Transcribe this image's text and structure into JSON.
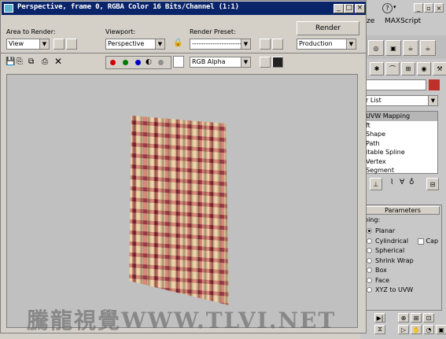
{
  "window": {
    "title": "Perspective, frame 0, RGBA Color 16 Bits/Channel (1:1)",
    "minimize_label": "_",
    "maximize_label": "□",
    "close_label": "×"
  },
  "toolbar": {
    "area_label": "Area to Render:",
    "area_value": "View",
    "viewport_label": "Viewport:",
    "viewport_value": "Perspective",
    "preset_label": "Render Preset:",
    "preset_value": "------------------------",
    "render_button": "Render",
    "production_value": "Production",
    "channel_value": "RGB Alpha",
    "channel_colors": [
      "#d00000",
      "#007a00",
      "#0000c0"
    ]
  },
  "background_app": {
    "menu_items": [
      "ze",
      "MAXScript"
    ],
    "modifier_list_label": "r List",
    "modifier_stack": [
      "UVW Mapping",
      "ft",
      "Shape",
      "Path",
      "itable Spline",
      "Vertex",
      "Segment"
    ],
    "parameters_title": "Parameters",
    "mapping_label": "ping:",
    "mapping_options": [
      "Planar",
      "Cylindrical",
      "Spherical",
      "Shrink Wrap",
      "Box",
      "Face",
      "XYZ to UVW"
    ],
    "mapping_selected": "Planar",
    "cap_label": "Cap",
    "accent_color": "#c0302a"
  },
  "render": {
    "fabric_colors": [
      "#c2353a",
      "#e9a66b",
      "#f3d3a1",
      "#8f2230"
    ]
  },
  "watermark": "騰龍視覺WWW.TLVI.NET"
}
